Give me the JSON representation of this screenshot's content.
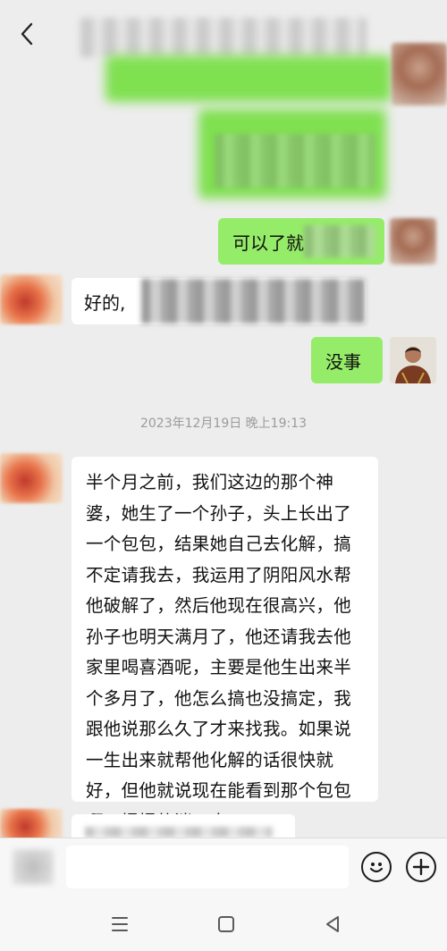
{
  "header": {
    "back_icon": "chevron-left-icon"
  },
  "messages": {
    "msg_keyi": "可以了就",
    "msg_haode": "好的,",
    "msg_meishi": "没事",
    "timestamp": "2023年12月19日 晚上19:13",
    "msg_long": "半个月之前，我们这边的那个神婆，她生了一个孙子，头上长出了一个包包，结果她自己去化解，搞不定请我去，我运用了阴阳风水帮他破解了，然后他现在很高兴，他孙子也明天满月了，他还请我去他家里喝喜酒呢，主要是他生出来半个多月了，他怎么搞也没搞定，我跟他说那么久了才来找我。如果说一生出来就帮他化解的话很快就好，但他就说现在能看到那个包包啊，慢慢的消下去。"
  },
  "input_bar": {
    "emoji_icon": "emoji-icon",
    "plus_icon": "plus-icon"
  },
  "nav": {
    "menu_icon": "menu-icon",
    "home_icon": "square-home-icon",
    "back_icon": "triangle-back-icon"
  },
  "colors": {
    "background": "#ededed",
    "bubble_green": "#95ec69",
    "bubble_white": "#ffffff",
    "timestamp_text": "#9b9b9b"
  }
}
